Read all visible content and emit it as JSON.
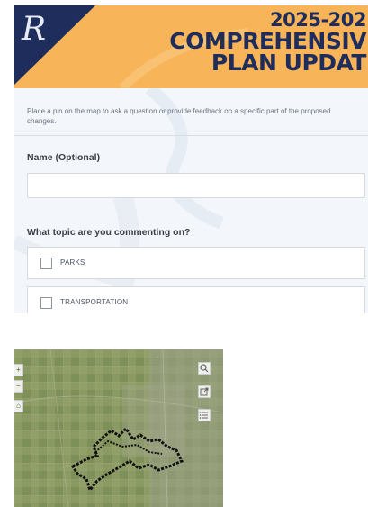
{
  "header": {
    "title_line1": "2025-202",
    "title_line2": "COMPREHENSIV",
    "title_line3": "PLAN UPDAT",
    "logo_letter": "R",
    "colors": {
      "banner": "#f7b458",
      "navy": "#1f2d5c"
    }
  },
  "form": {
    "intro": "Place a pin on the map to ask a question or provide feedback on a specific part of the proposed changes.",
    "name_label": "Name (Optional)",
    "name_value": "",
    "topic_label": "What topic are you commenting on?",
    "options": [
      {
        "label": "PARKS",
        "checked": false
      },
      {
        "label": "TRANSPORTATION",
        "checked": false
      }
    ]
  },
  "map": {
    "controls": {
      "zoom_in": "+",
      "zoom_out": "−",
      "home_icon": "home-icon",
      "search_icon": "search-icon",
      "share_icon": "share-icon",
      "legend_icon": "legend-icon"
    }
  }
}
